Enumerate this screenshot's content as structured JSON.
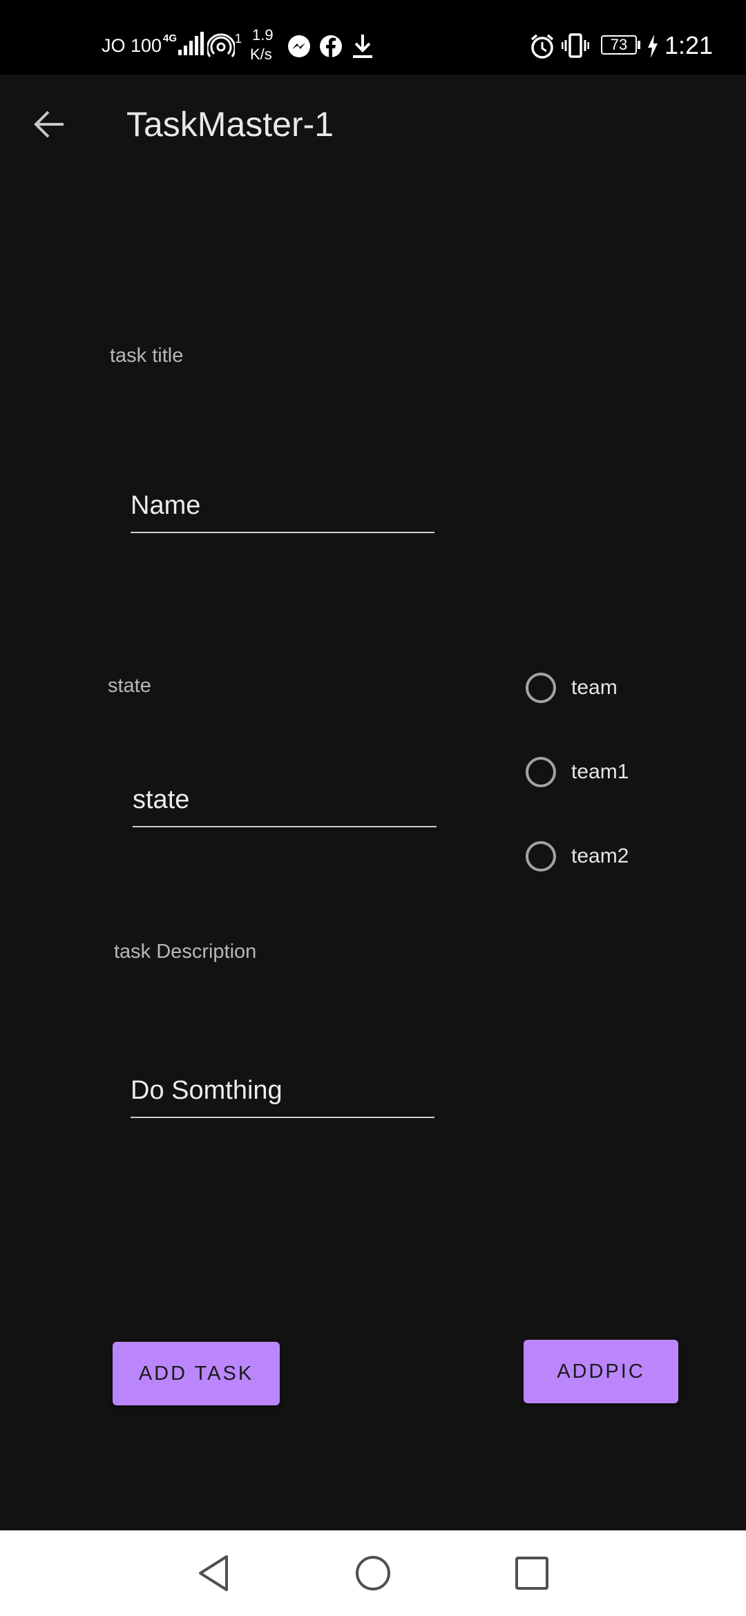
{
  "status_bar": {
    "carrier": "JO 100",
    "network_type": "4G",
    "hotspot_count": "1",
    "speed_value": "1.9",
    "speed_unit": "K/s",
    "battery": "73",
    "time": "1:21"
  },
  "app_bar": {
    "title": "TaskMaster-1",
    "back_icon": "arrow-left-icon"
  },
  "form": {
    "title_label": "task title",
    "title_value": "Name",
    "state_label": "state",
    "state_value": "state",
    "description_label": "task Description",
    "description_value": "Do Somthing"
  },
  "teams": [
    {
      "label": "team",
      "selected": false
    },
    {
      "label": "team1",
      "selected": false
    },
    {
      "label": "team2",
      "selected": false
    }
  ],
  "buttons": {
    "add_task": "ADD TASK",
    "add_pic": "ADDPIC"
  },
  "colors": {
    "background": "#121212",
    "accent": "#bb86fc",
    "status_bar": "#000000",
    "nav_bar": "#ffffff"
  }
}
